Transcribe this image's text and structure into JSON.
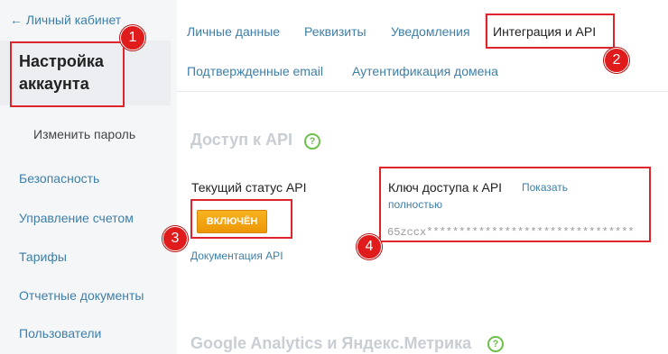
{
  "sidebar": {
    "back_label": "← Личный кабинет",
    "active_label": "Настройка аккаунта",
    "sub_item": "Изменить пароль",
    "items": [
      {
        "label": "Безопасность"
      },
      {
        "label": "Управление счетом"
      },
      {
        "label": "Тарифы"
      },
      {
        "label": "Отчетные документы"
      },
      {
        "label": "Пользователи"
      }
    ]
  },
  "tabs": [
    {
      "label": "Личные данные"
    },
    {
      "label": "Реквизиты"
    },
    {
      "label": "Уведомления"
    },
    {
      "label": "Интеграция и API",
      "active": true
    },
    {
      "label": "Подтвержденные email"
    },
    {
      "label": "Аутентификация домена"
    }
  ],
  "api_section": {
    "title": "Доступ к API",
    "status_label": "Текущий статус API",
    "status_button": "ВКЛЮЧЁН",
    "docs_link": "Документация API",
    "key_label": "Ключ доступа к API",
    "show_link_part1": "Показать",
    "show_link_part2": "полностью",
    "key_value": "65zccx********************************"
  },
  "analytics_section": {
    "title": "Google Analytics и Яндекс.Метрика"
  },
  "help_icon_glyph": "?",
  "annotations": [
    "1",
    "2",
    "3",
    "4"
  ],
  "colors": {
    "link": "#3d7fa8",
    "highlight": "#e0242b",
    "button": "#f5a612",
    "help": "#6cc04a"
  }
}
